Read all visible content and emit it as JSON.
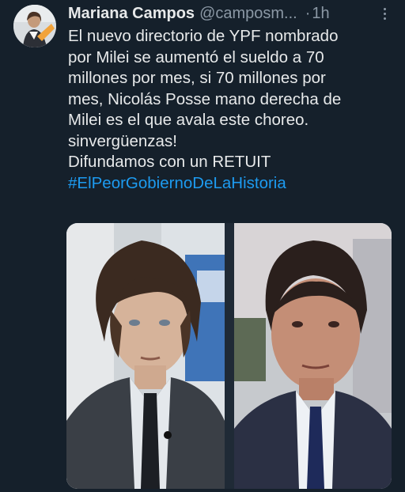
{
  "author": {
    "name": "Mariana Campos",
    "handle": "@camposm...",
    "separator": "·",
    "time": "1h"
  },
  "tweet": {
    "lines": [
      "El nuevo directorio de YPF nombrado",
      "por Milei se aumentó el sueldo a 70",
      "millones por mes, si 70 millones por",
      "mes, Nicolás Posse mano derecha de",
      "Milei es el que avala este choreo.",
      "sinvergüenzas!",
      "Difundamos con un RETUIT"
    ],
    "hashtag": "#ElPeorGobiernoDeLaHistoria"
  },
  "icons": {
    "more": "more-options-icon"
  },
  "colors": {
    "background": "#15202b",
    "text": "#e7e9ea",
    "secondary": "#8b98a5",
    "link": "#1d9bf0"
  }
}
